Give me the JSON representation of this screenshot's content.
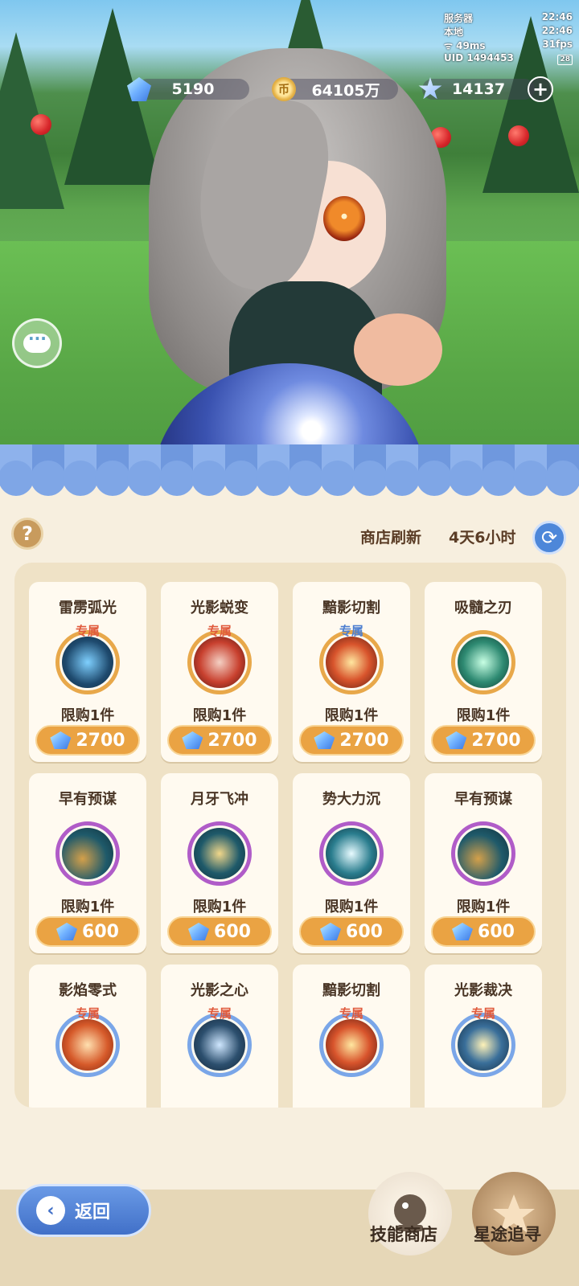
{
  "status": {
    "server_label": "服务器",
    "server_time": "22:46",
    "local_label": "本地",
    "local_time": "22:46",
    "ping": "49ms",
    "fps": "31fps",
    "uid": "UID 1494453",
    "battery": "28"
  },
  "currencies": {
    "gems": "5190",
    "coins": "64105万",
    "stars": "14137"
  },
  "shop": {
    "refresh_label": "商店刷新",
    "refresh_time": "4天6小时",
    "items": [
      {
        "name": "雷雳弧光",
        "tag": "专属",
        "limit": "限购1件",
        "price": "2700"
      },
      {
        "name": "光影蜕变",
        "tag": "专属",
        "limit": "限购1件",
        "price": "2700"
      },
      {
        "name": "黯影切割",
        "tag": "专属",
        "limit": "限购1件",
        "price": "2700"
      },
      {
        "name": "吸髓之刃",
        "tag": "",
        "limit": "限购1件",
        "price": "2700"
      },
      {
        "name": "早有预谋",
        "tag": "",
        "limit": "限购1件",
        "price": "600"
      },
      {
        "name": "月牙飞冲",
        "tag": "",
        "limit": "限购1件",
        "price": "600"
      },
      {
        "name": "势大力沉",
        "tag": "",
        "limit": "限购1件",
        "price": "600"
      },
      {
        "name": "早有预谋",
        "tag": "",
        "limit": "限购1件",
        "price": "600"
      },
      {
        "name": "影焰零式",
        "tag": "专属"
      },
      {
        "name": "光影之心",
        "tag": "专属"
      },
      {
        "name": "黯影切割",
        "tag": "专属"
      },
      {
        "name": "光影裁决",
        "tag": "专属"
      }
    ]
  },
  "nav": {
    "back": "返回",
    "skill_shop": "技能商店",
    "star_pursuit": "星途追寻"
  },
  "colors": {
    "price_orange": "#eaa343",
    "tag_red": "#e05a3c",
    "tag_blue": "#4d7fd0",
    "back_blue": "#4170c8"
  }
}
